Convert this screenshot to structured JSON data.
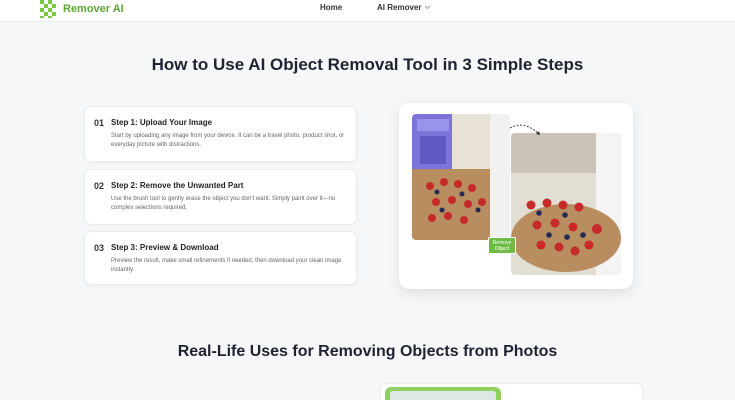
{
  "header": {
    "brand_name": "Remover AI",
    "nav": {
      "home": "Home",
      "ai_remover": "AI Remover"
    }
  },
  "section1": {
    "title": "How to Use AI Object Removal Tool in 3 Simple Steps",
    "steps": [
      {
        "num": "01",
        "title": "Step 1: Upload Your Image",
        "desc": "Start by uploading any image from your device. It can be a travel photo, product shot, or everyday picture with distractions."
      },
      {
        "num": "02",
        "title": "Step 2: Remove the Unwanted Part",
        "desc": "Use the brush tool to gently erase the object you don't want. Simply paint over it—no complex selections required."
      },
      {
        "num": "03",
        "title": "Step 3: Preview & Download",
        "desc": "Preview the result, make small refinements if needed, then download your clean image instantly."
      }
    ],
    "preview": {
      "remove_label": "Remove",
      "remove_sub": "Object"
    }
  },
  "section2": {
    "title": "Real-Life Uses for Removing Objects from Photos"
  },
  "colors": {
    "brand_green": "#6fba45",
    "title_dark": "#1f2230"
  }
}
